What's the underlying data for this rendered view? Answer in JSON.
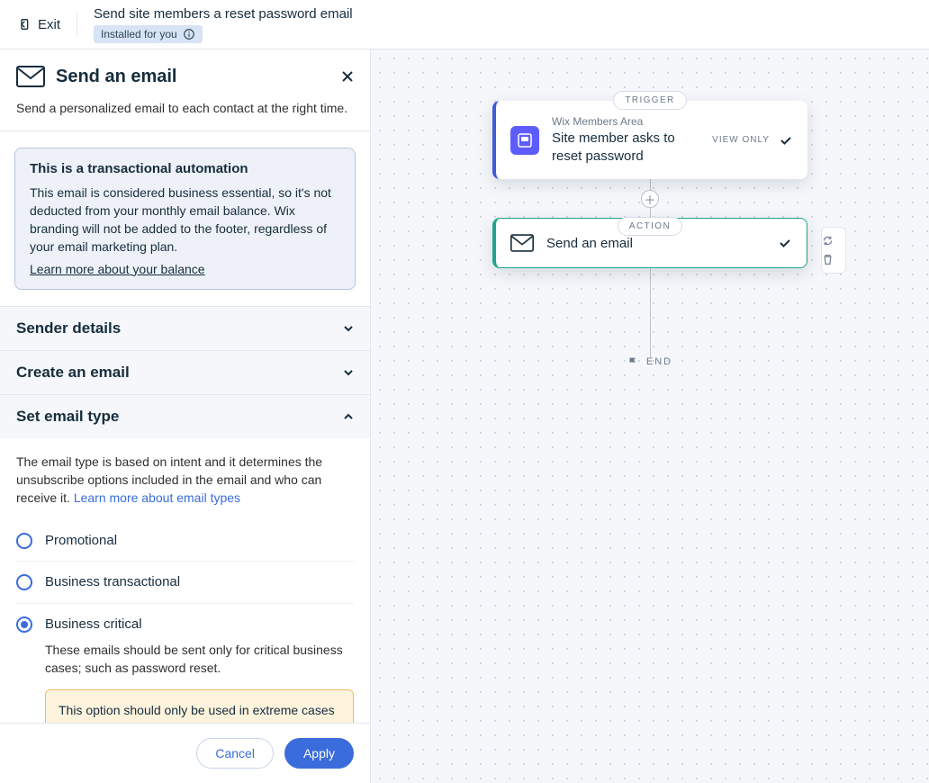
{
  "topbar": {
    "exit": "Exit",
    "title": "Send site members a reset password email",
    "badge": "Installed for you"
  },
  "panel": {
    "title": "Send an email",
    "subtitle": "Send a personalized email to each contact at the right time.",
    "info": {
      "title": "This is a transactional automation",
      "body": "This email is considered business essential, so it's not deducted from your monthly email balance. Wix branding will not be added to the footer, regardless of your email marketing plan.",
      "link": "Learn more about your balance"
    },
    "accordion": {
      "sender": "Sender details",
      "create": "Create an email",
      "type": {
        "label": "Set email type",
        "desc_pre": "The email type is based on intent and it determines the unsubscribe options included in the email and who can receive it. ",
        "desc_link": "Learn more about email types",
        "options": [
          {
            "label": "Promotional",
            "selected": false
          },
          {
            "label": "Business transactional",
            "selected": false
          },
          {
            "label": "Business critical",
            "selected": true,
            "desc": "These emails should be sent only for critical business cases; such as password reset.",
            "warn": "This option should only be used in extreme cases as it may expose you to legal litigation when used inappropriately. We recommend"
          }
        ]
      }
    },
    "footer": {
      "cancel": "Cancel",
      "apply": "Apply"
    }
  },
  "canvas": {
    "trigger_pill": "TRIGGER",
    "trigger": {
      "overline": "Wix Members Area",
      "title": "Site member asks to reset password",
      "status": "VIEW ONLY"
    },
    "action_pill": "ACTION",
    "action": {
      "title": "Send an email"
    },
    "end": "END"
  }
}
